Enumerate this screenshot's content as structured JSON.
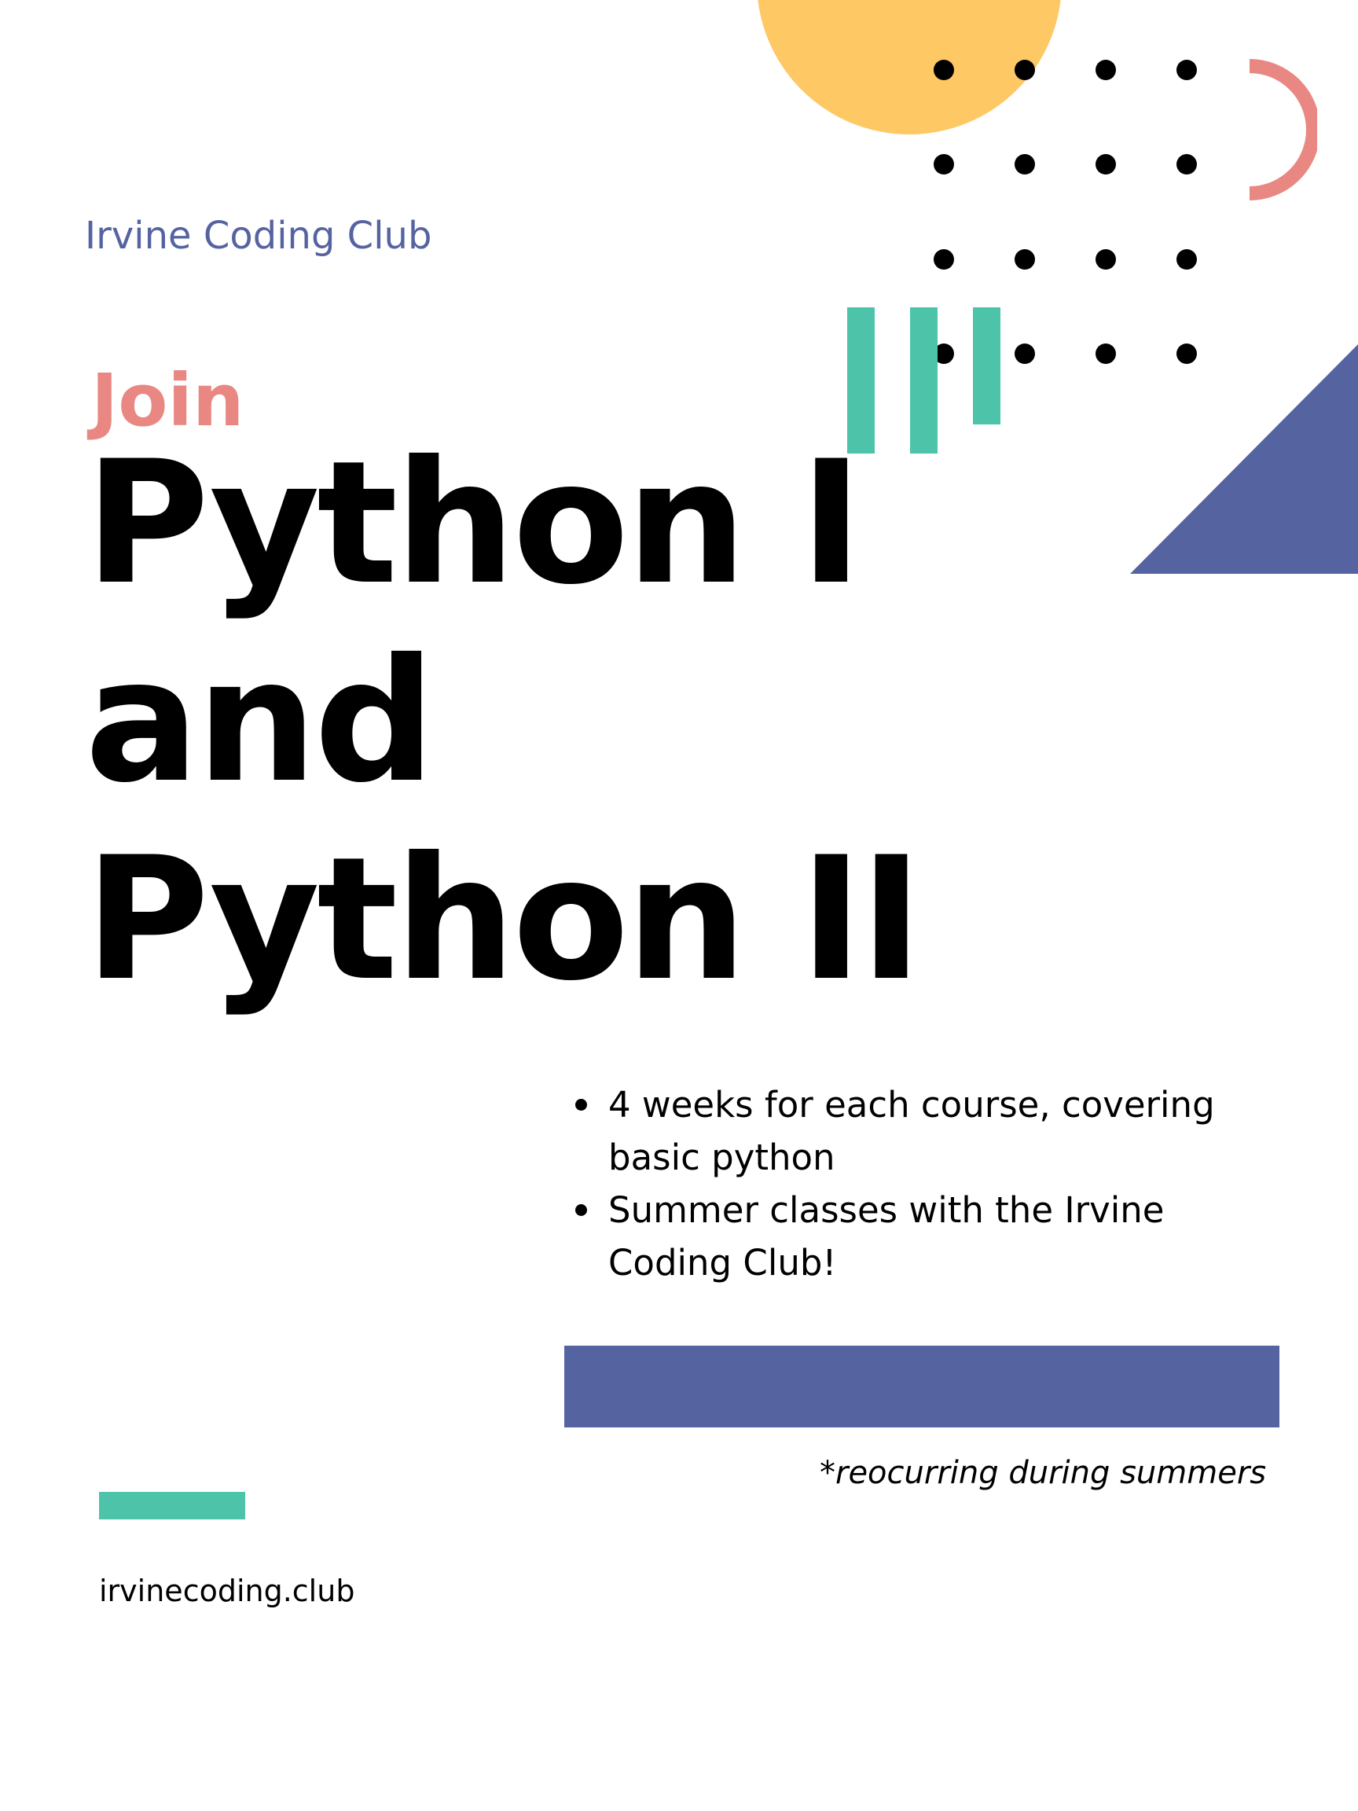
{
  "poster": {
    "organization": "Irvine Coding Club",
    "call_to_action": "Join",
    "headline": {
      "line1": "Python I",
      "line2": "and",
      "line3": "Python II"
    },
    "details": [
      "4 weeks for each course, covering basic python",
      "Summer classes with the Irvine Coding Club!"
    ],
    "footnote": "*reocurring during summers",
    "website": "irvinecoding.club"
  },
  "colors": {
    "background": "#FFFFFF",
    "primary_purple": "#5563A1",
    "accent_coral": "#E98782",
    "accent_teal": "#4DC4A9",
    "accent_yellow": "#FEC864",
    "text": "#000000"
  },
  "decorations": {
    "sun": "yellow-circle",
    "dots": "dot-grid-4x4",
    "ring": "coral-half-ring",
    "bars": "teal-vertical-bars",
    "triangle": "purple-triangle",
    "band": "purple-band",
    "dash": "teal-dash"
  }
}
